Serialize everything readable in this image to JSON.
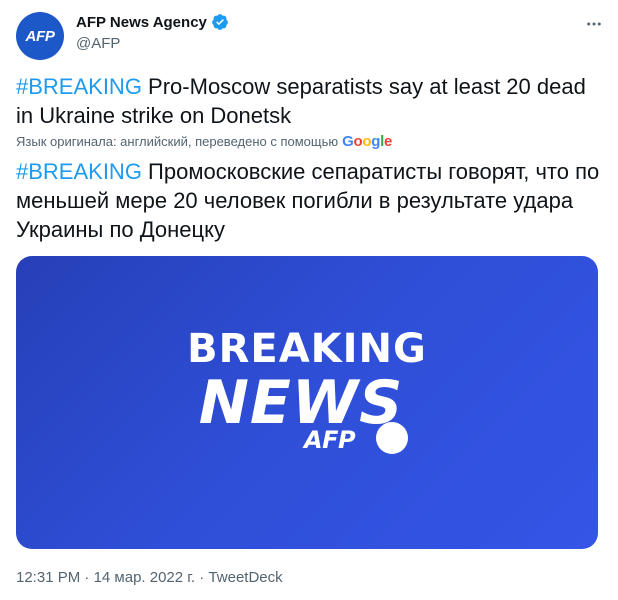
{
  "author": {
    "avatar_text": "AFP",
    "display_name": "AFP News Agency",
    "handle": "@AFP"
  },
  "tweet": {
    "original_hashtag": "#BREAKING",
    "original_text": " Pro-Moscow separatists say at least 20 dead in Ukraine strike on Donetsk",
    "translation_note": "Язык оригинала: английский, переведено с помощью",
    "translated_hashtag": "#BREAKING",
    "translated_text": " Промосковские сепаратисты говорят, что по меньшей мере 20 человек погибли в результате удара Украины по Донецку"
  },
  "google_logo": [
    "G",
    "o",
    "o",
    "g",
    "l",
    "e"
  ],
  "media": {
    "line1": "BREAKING",
    "line2": "NEWS",
    "brand": "AFP"
  },
  "meta": {
    "time": "12:31 PM",
    "separator": " · ",
    "date": "14 мар. 2022 г.",
    "source": "TweetDeck"
  },
  "colors": {
    "link": "#1d9bf0",
    "avatar_bg": "#1d58c9",
    "media_bg": "#2f4fd8",
    "verified": "#1d9bf0"
  }
}
